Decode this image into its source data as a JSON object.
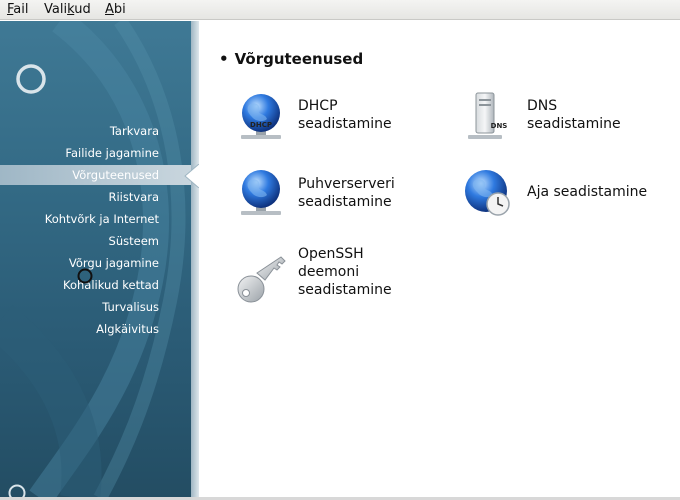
{
  "menubar": {
    "items": [
      {
        "label_acc": "F",
        "label_rest": "ail"
      },
      {
        "label_pre": "Vali",
        "label_acc": "k",
        "label_rest": "ud"
      },
      {
        "label_acc": "A",
        "label_rest": "bi"
      }
    ]
  },
  "sidebar": {
    "items": [
      {
        "label": "Tarkvara"
      },
      {
        "label": "Failide jagamine"
      },
      {
        "label": "Võrguteenused"
      },
      {
        "label": "Riistvara"
      },
      {
        "label": "Kohtvõrk ja Internet"
      },
      {
        "label": "Süsteem"
      },
      {
        "label": "Võrgu jagamine"
      },
      {
        "label": "Kohalikud kettad"
      },
      {
        "label": "Turvalisus"
      },
      {
        "label": "Algkäivitus"
      }
    ],
    "active_index": 2
  },
  "main": {
    "section_title": "Võrguteenused",
    "tools": [
      {
        "label": "DHCP\nseadistamine",
        "icon": "dhcp-globe-icon",
        "badge": "DHCP"
      },
      {
        "label": "DNS\nseadistamine",
        "icon": "dns-server-icon",
        "badge": "DNS"
      },
      {
        "label": "Puhverserveri\nseadistamine",
        "icon": "proxy-globe-icon"
      },
      {
        "label": "Aja seadistamine",
        "icon": "time-globe-icon"
      },
      {
        "label": "OpenSSH\ndeemoni\nseadistamine",
        "icon": "key-icon"
      }
    ]
  },
  "colors": {
    "sidebar": "#336a85",
    "active_item": "#b4c7d2",
    "globe": "#2a6ad0"
  }
}
